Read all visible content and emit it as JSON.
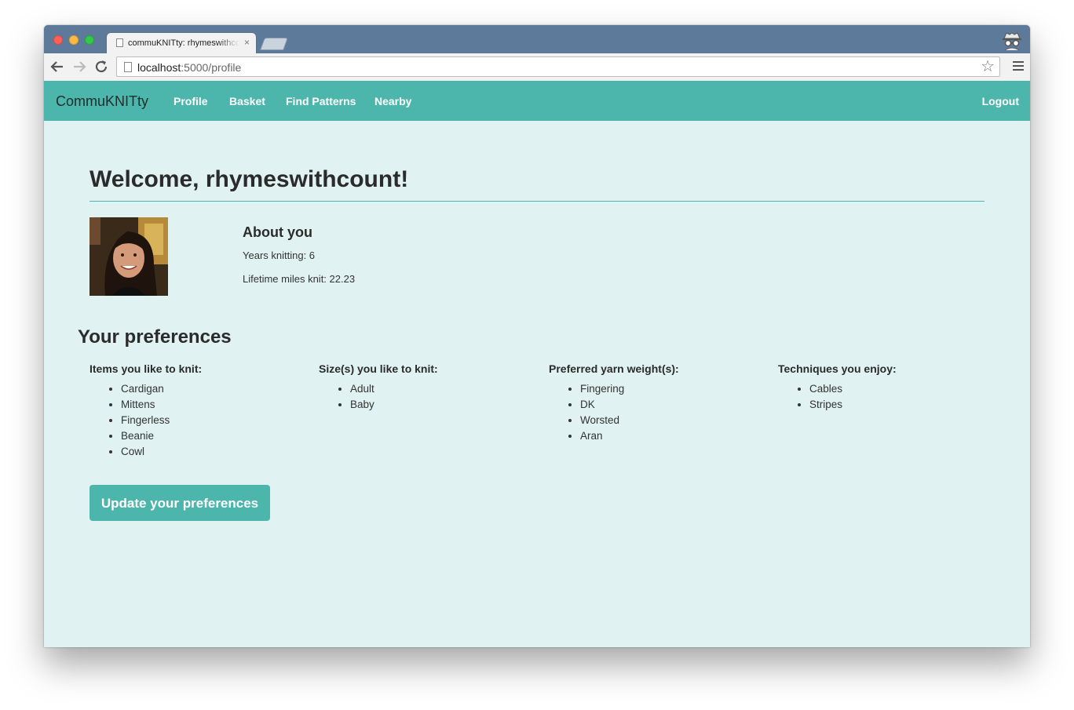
{
  "browser": {
    "tab_title": "commuKNITty: rhymeswithcount",
    "tab_close": "×",
    "url_host": "localhost",
    "url_rest": ":5000/profile"
  },
  "nav": {
    "brand": "CommuKNITty",
    "links": [
      "Profile",
      "Basket",
      "Find Patterns",
      "Nearby"
    ],
    "logout": "Logout"
  },
  "profile": {
    "welcome": "Welcome, rhymeswithcount!",
    "about_title": "About you",
    "years_knitting": "Years knitting: 6",
    "lifetime_miles": "Lifetime miles knit: 22.23"
  },
  "preferences": {
    "title": "Your preferences",
    "columns": [
      {
        "heading": "Items you like to knit:",
        "items": [
          "Cardigan",
          "Mittens",
          "Fingerless",
          "Beanie",
          "Cowl"
        ]
      },
      {
        "heading": "Size(s) you like to knit:",
        "items": [
          "Adult",
          "Baby"
        ]
      },
      {
        "heading": "Preferred yarn weight(s):",
        "items": [
          "Fingering",
          "DK",
          "Worsted",
          "Aran"
        ]
      },
      {
        "heading": "Techniques you enjoy:",
        "items": [
          "Cables",
          "Stripes"
        ]
      }
    ],
    "update_button": "Update your preferences"
  },
  "colors": {
    "accent": "#4db6ac",
    "page_background": "#e0f2f1",
    "chrome_tabbar": "#5e7a9a"
  },
  "icons": [
    "page-icon",
    "back-arrow-icon",
    "forward-arrow-icon",
    "reload-icon",
    "bookmark-star-icon",
    "menu-icon",
    "incognito-icon"
  ]
}
